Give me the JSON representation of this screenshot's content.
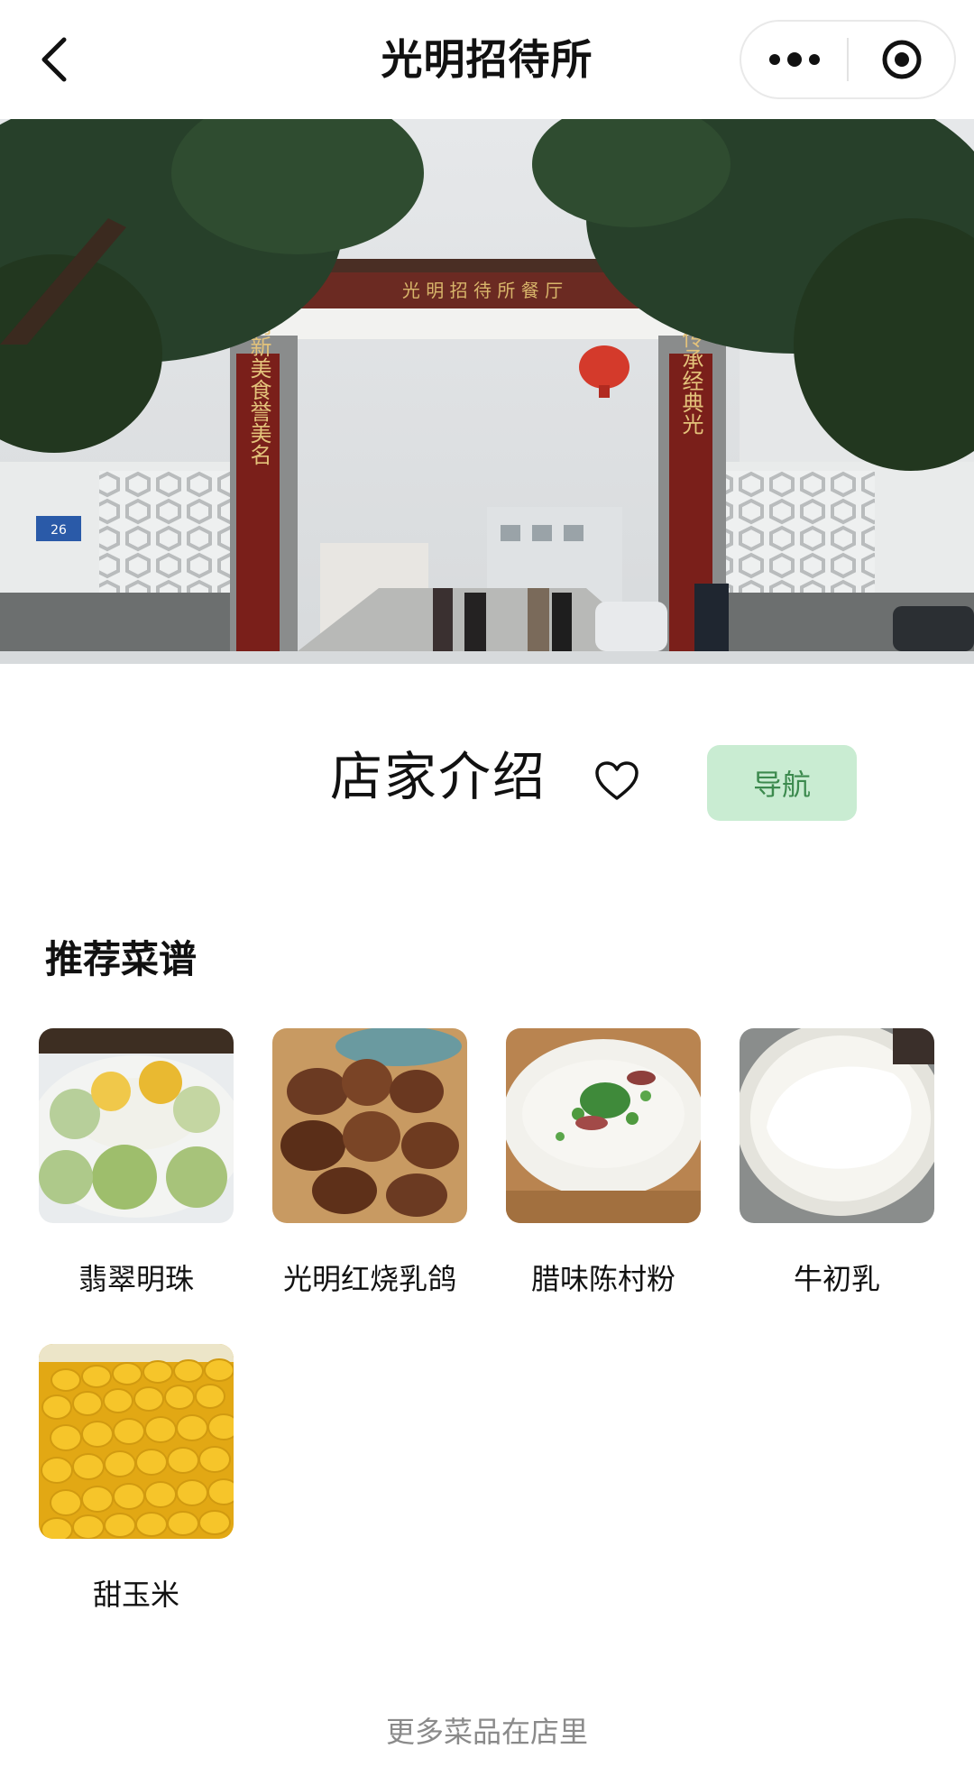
{
  "navbar": {
    "title": "光明招待所",
    "back_icon": "chevron-left-icon",
    "more_icon": "more-dots-icon",
    "target_icon": "target-icon"
  },
  "hero": {
    "description_icon": "storefront-photo",
    "gate_sign": "光明招待所餐厅",
    "couplet_left": "创新美食誉美名",
    "couplet_right": "传承经典光",
    "plate_text": "26"
  },
  "intro": {
    "title": "店家介绍",
    "favorite_icon": "heart-outline-icon",
    "navigate_label": "导航",
    "accent_color": "#c9ecd2"
  },
  "recommended": {
    "title": "推荐菜谱",
    "dishes": [
      {
        "name": "翡翠明珠",
        "icon": "dish-photo"
      },
      {
        "name": "光明红烧乳鸽",
        "icon": "dish-photo"
      },
      {
        "name": "腊味陈村粉",
        "icon": "dish-photo"
      },
      {
        "name": "牛初乳",
        "icon": "dish-photo"
      },
      {
        "name": "甜玉米",
        "icon": "dish-photo"
      }
    ]
  },
  "footer": {
    "note": "更多菜品在店里"
  }
}
